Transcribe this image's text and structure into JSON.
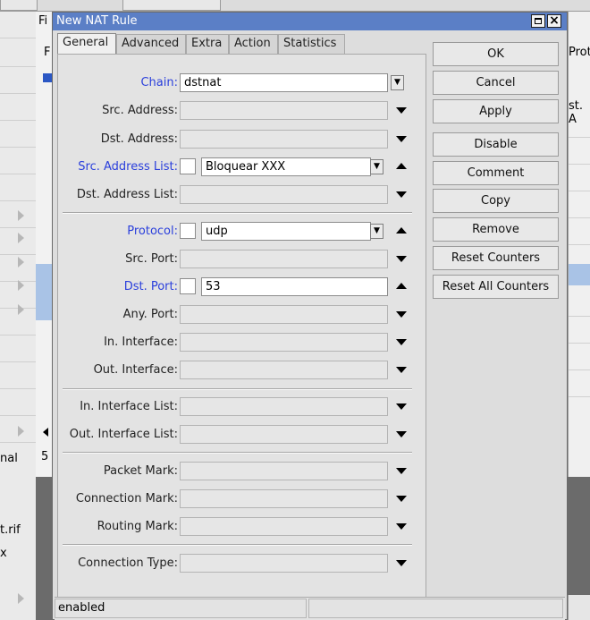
{
  "background": {
    "left_fragments": [
      "nal",
      "t.rif",
      "x"
    ],
    "mid_fragments": [
      "Fi",
      "F",
      "5"
    ],
    "right_fragments": [
      "Prot",
      "st. A"
    ]
  },
  "dialog": {
    "title": "New NAT Rule",
    "tabs": [
      "General",
      "Advanced",
      "Extra",
      "Action",
      "Statistics"
    ],
    "active_tab": "General",
    "fields": {
      "chain": {
        "label": "Chain:",
        "value": "dstnat"
      },
      "src_address": {
        "label": "Src. Address:",
        "value": ""
      },
      "dst_address": {
        "label": "Dst. Address:",
        "value": ""
      },
      "src_address_list": {
        "label": "Src. Address List:",
        "value": "Bloquear XXX"
      },
      "dst_address_list": {
        "label": "Dst. Address List:",
        "value": ""
      },
      "protocol": {
        "label": "Protocol:",
        "value": "udp"
      },
      "src_port": {
        "label": "Src. Port:",
        "value": ""
      },
      "dst_port": {
        "label": "Dst. Port:",
        "value": "53"
      },
      "any_port": {
        "label": "Any. Port:",
        "value": ""
      },
      "in_interface": {
        "label": "In. Interface:",
        "value": ""
      },
      "out_interface": {
        "label": "Out. Interface:",
        "value": ""
      },
      "in_interface_list": {
        "label": "In. Interface List:",
        "value": ""
      },
      "out_interface_list": {
        "label": "Out. Interface List:",
        "value": ""
      },
      "packet_mark": {
        "label": "Packet Mark:",
        "value": ""
      },
      "connection_mark": {
        "label": "Connection Mark:",
        "value": ""
      },
      "routing_mark": {
        "label": "Routing Mark:",
        "value": ""
      },
      "connection_type": {
        "label": "Connection Type:",
        "value": ""
      }
    },
    "buttons": {
      "ok": "OK",
      "cancel": "Cancel",
      "apply": "Apply",
      "disable": "Disable",
      "comment": "Comment",
      "copy": "Copy",
      "remove": "Remove",
      "reset_counters": "Reset Counters",
      "reset_all_counters": "Reset All Counters"
    },
    "status": "enabled"
  },
  "colors": {
    "titlebar": "#5b7fc6",
    "label_highlight": "#2a3fdc",
    "selection": "#a9c3e6"
  },
  "icons": {
    "dropdown_button": "triangle-down-with-bar",
    "remove_field_arrow": "triangle-up",
    "expand_field_arrow": "triangle-down"
  }
}
